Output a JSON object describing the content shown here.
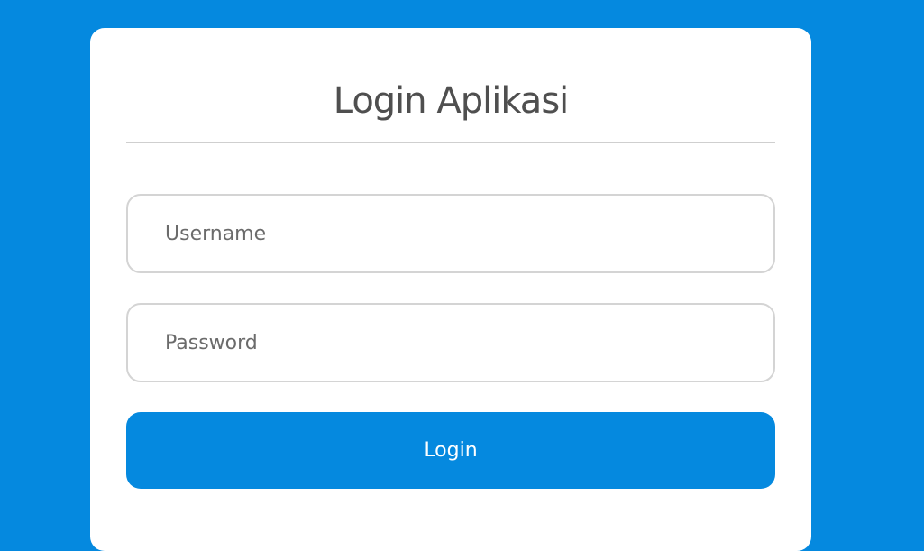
{
  "login_card": {
    "title": "Login Aplikasi",
    "username_placeholder": "Username",
    "password_placeholder": "Password",
    "login_label": "Login"
  },
  "colors": {
    "background": "#0589df",
    "button": "#0589df",
    "card": "#ffffff",
    "title_text": "#4f4f4f",
    "field_border": "#d4d4d4"
  }
}
